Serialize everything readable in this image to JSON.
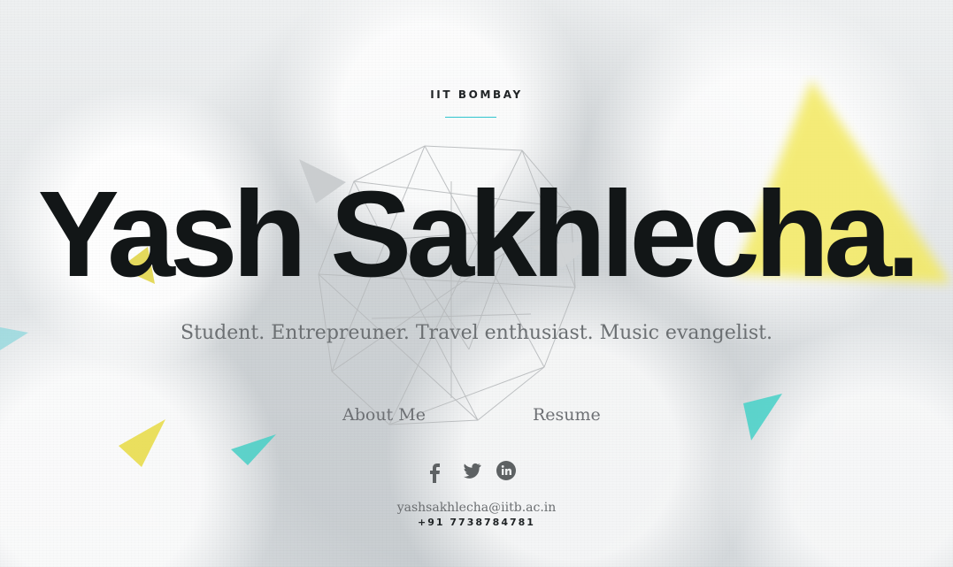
{
  "hero": {
    "institution": "IIT BOMBAY",
    "name": "Yash Sakhlecha.",
    "tagline": "Student. Entrepreuner. Travel enthusiast. Music evangelist."
  },
  "nav": {
    "about_label": "About Me",
    "resume_label": "Resume"
  },
  "social": {
    "facebook_icon": "facebook-icon",
    "twitter_icon": "twitter-icon",
    "linkedin_icon": "linkedin-icon"
  },
  "contact": {
    "email": "yashsakhlecha@iitb.ac.in",
    "phone": "+91 7738784781"
  },
  "colors": {
    "accent_cyan": "#30c5cf",
    "accent_yellow": "#f5ea5e",
    "text_dark": "#121617",
    "text_muted": "#6b6f72"
  }
}
